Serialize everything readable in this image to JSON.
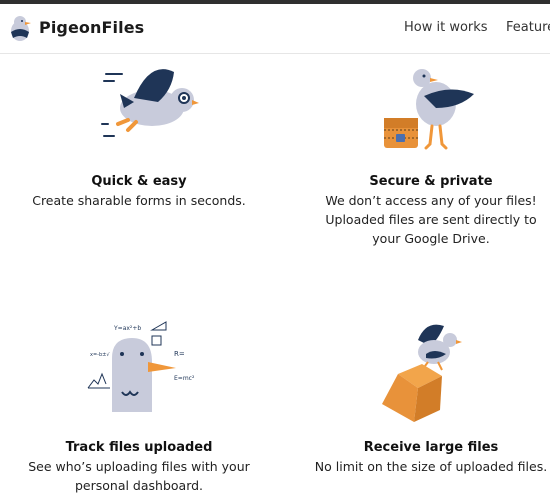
{
  "header": {
    "brand": "PigeonFiles",
    "logo_icon": "pigeon-logo-icon",
    "nav": [
      {
        "label": "How it works"
      },
      {
        "label": "Feature"
      }
    ]
  },
  "features": [
    {
      "title": "Quick & easy",
      "lines": [
        "Create sharable forms in seconds."
      ],
      "icon": "flying-pigeon-icon"
    },
    {
      "title": "Secure & private",
      "lines": [
        "We don’t access any of your files!",
        "Uploaded files are sent directly to",
        "your Google Drive."
      ],
      "icon": "pigeon-on-chest-icon"
    },
    {
      "title": "Track files uploaded",
      "lines": [
        "See who’s uploading files with your",
        "personal dashboard."
      ],
      "icon": "thinking-pigeon-icon"
    },
    {
      "title": "Receive large files",
      "lines": [
        "No limit on the size of uploaded files."
      ],
      "icon": "pigeon-carrying-box-icon"
    }
  ],
  "colors": {
    "pigeon_body": "#c8cbdb",
    "wing": "#1f3557",
    "beak": "#f0973a",
    "box": "#e8923a"
  }
}
